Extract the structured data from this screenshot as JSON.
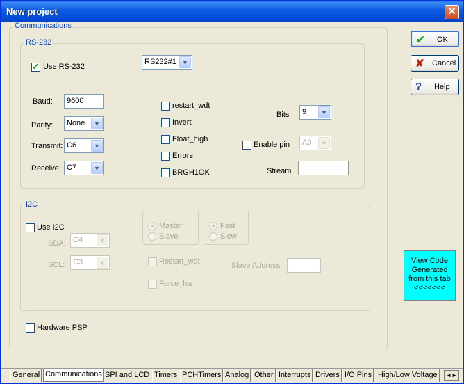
{
  "window": {
    "title": "New project",
    "close_glyph": "✕"
  },
  "communications": {
    "group_label": "Communications",
    "rs232": {
      "group_label": "RS-232",
      "use_label": "Use RS-232",
      "use_checked": true,
      "stream_select": "RS232#1",
      "baud_label": "Baud:",
      "baud_value": "9600",
      "parity_label": "Parity:",
      "parity_value": "None",
      "transmit_label": "Transmit:",
      "transmit_value": "C6",
      "receive_label": "Receive:",
      "receive_value": "C7",
      "options": [
        "restart_wdt",
        "Invert",
        "Float_high",
        "Errors",
        "BRGH1OK"
      ],
      "bits_label": "Bits",
      "bits_value": "9",
      "enable_pin_label": "Enable pin",
      "enable_pin_value": "A0",
      "stream_label": "Stream",
      "stream_value": ""
    },
    "i2c": {
      "group_label": "I2C",
      "use_label": "Use I2C",
      "sda_label": "SDA:",
      "sda_value": "C4",
      "scl_label": "SCL:",
      "scl_value": "C3",
      "mode": [
        "Master",
        "Slave"
      ],
      "speed": [
        "Fast",
        "Slow"
      ],
      "restart_label": "Restart_wdt",
      "force_label": "Force_hw",
      "slave_address_label": "Slave Address",
      "slave_address_value": ""
    },
    "hardware_psp_label": "Hardware PSP"
  },
  "buttons": {
    "ok": "OK",
    "ok_icon": "✔",
    "cancel": "Cancel",
    "cancel_icon": "✘",
    "help": "Help",
    "help_icon": "?"
  },
  "view_code": {
    "line1": "View Code",
    "line2": "Generated",
    "line3": "from this tab",
    "line4": "<<<<<<<"
  },
  "tabs": [
    "General",
    "Communications",
    "SPI and LCD",
    "Timers",
    "PCHTimers",
    "Analog",
    "Other",
    "Interrupts",
    "Drivers",
    "I/O Pins",
    "High/Low Voltage"
  ],
  "tab_scroll": "◄►",
  "colors": {
    "titlebar": "#0a5fe6",
    "group_label": "#0046d5",
    "view_code_bg": "#00ffff"
  }
}
